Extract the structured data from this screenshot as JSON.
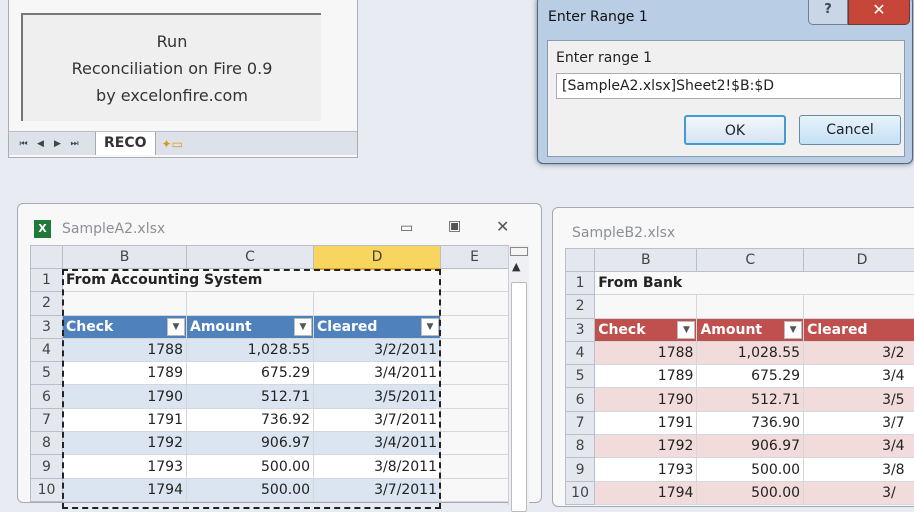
{
  "macro": {
    "button_lines": [
      "Run",
      "Reconciliation on Fire 0.9",
      "by excelonfire.com"
    ],
    "sheet_tab": "RECO",
    "nav": [
      "⏮",
      "◀",
      "▶",
      "⏭"
    ]
  },
  "dialog": {
    "title": "Enter Range 1",
    "help": "?",
    "close": "✕",
    "label": "Enter range 1",
    "value": "[SampleA2.xlsx]Sheet2!$B:$D",
    "ok": "OK",
    "cancel": "Cancel"
  },
  "workbookA": {
    "title": "SampleA2.xlsx",
    "columns": [
      "B",
      "C",
      "D",
      "E"
    ],
    "row_numbers": [
      "1",
      "2",
      "3",
      "4",
      "5",
      "6",
      "7",
      "8",
      "9",
      "10"
    ],
    "caption": "From Accounting System",
    "headers": [
      "Check",
      "Amount",
      "Cleared"
    ],
    "rows": [
      [
        "1788",
        "1,028.55",
        "3/2/2011"
      ],
      [
        "1789",
        "675.29",
        "3/4/2011"
      ],
      [
        "1790",
        "512.71",
        "3/5/2011"
      ],
      [
        "1791",
        "736.92",
        "3/7/2011"
      ],
      [
        "1792",
        "906.97",
        "3/4/2011"
      ],
      [
        "1793",
        "500.00",
        "3/8/2011"
      ],
      [
        "1794",
        "500.00",
        "3/7/2011"
      ]
    ],
    "header_color": "#4f81bd",
    "band_color": "#dbe5f1"
  },
  "workbookB": {
    "title": "SampleB2.xlsx",
    "columns": [
      "B",
      "C",
      "D"
    ],
    "row_numbers": [
      "1",
      "2",
      "3",
      "4",
      "5",
      "6",
      "7",
      "8",
      "9",
      "10"
    ],
    "caption": "From Bank",
    "headers": [
      "Check",
      "Amount",
      "Cleared"
    ],
    "rows": [
      [
        "1788",
        "1,028.55",
        "3/2"
      ],
      [
        "1789",
        "675.29",
        "3/4"
      ],
      [
        "1790",
        "512.71",
        "3/5"
      ],
      [
        "1791",
        "736.90",
        "3/7"
      ],
      [
        "1792",
        "906.97",
        "3/4"
      ],
      [
        "1793",
        "500.00",
        "3/8"
      ],
      [
        "1794",
        "500.00",
        "3/"
      ]
    ],
    "header_color": "#c0504d",
    "band_color": "#f2dcdb"
  }
}
